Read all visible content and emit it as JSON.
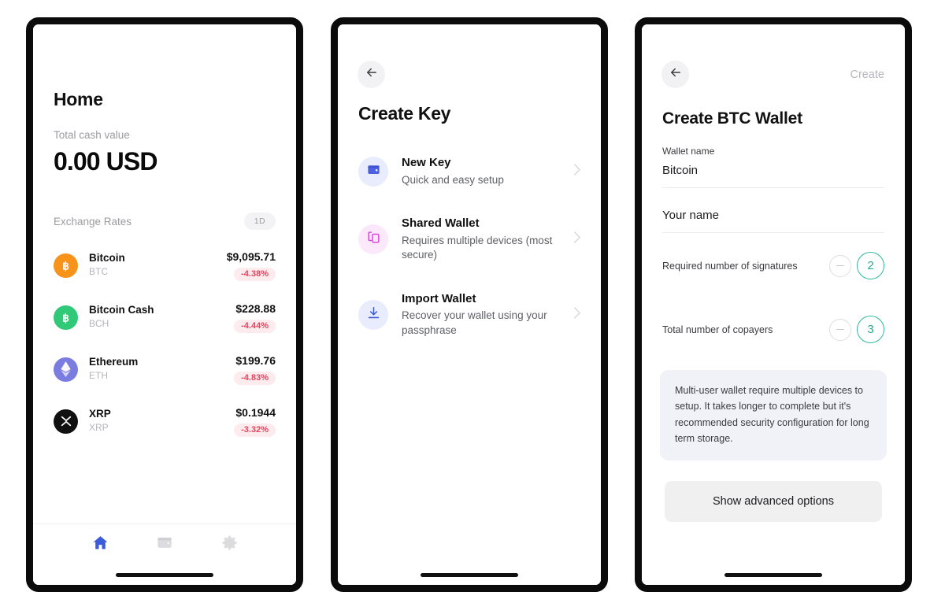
{
  "screen1": {
    "title": "Home",
    "balance_label": "Total cash value",
    "balance_value": "0.00 USD",
    "rates_label": "Exchange Rates",
    "range_badge": "1D",
    "coins": [
      {
        "name": "Bitcoin",
        "ticker": "BTC",
        "price": "$9,095.71",
        "change": "-4.38%",
        "icon": "bitcoin-icon",
        "color": "#f7931a"
      },
      {
        "name": "Bitcoin Cash",
        "ticker": "BCH",
        "price": "$228.88",
        "change": "-4.44%",
        "icon": "bitcoin-cash-icon",
        "color": "#2fc978"
      },
      {
        "name": "Ethereum",
        "ticker": "ETH",
        "price": "$199.76",
        "change": "-4.83%",
        "icon": "ethereum-icon",
        "color": "#7b7ce0"
      },
      {
        "name": "XRP",
        "ticker": "XRP",
        "price": "$0.1944",
        "change": "-3.32%",
        "icon": "xrp-icon",
        "color": "#101010"
      }
    ],
    "tabs": [
      {
        "icon": "home-icon",
        "active": true
      },
      {
        "icon": "wallet-icon",
        "active": false
      },
      {
        "icon": "gear-icon",
        "active": false
      }
    ]
  },
  "screen2": {
    "back_icon": "back-arrow-icon",
    "title": "Create Key",
    "options": [
      {
        "title": "New Key",
        "subtitle": "Quick and easy setup",
        "icon": "wallet-icon",
        "icon_color": "#4c61e0",
        "icon_bg": "#e8ecfd"
      },
      {
        "title": "Shared Wallet",
        "subtitle": "Requires multiple devices (most secure)",
        "icon": "copy-icon",
        "icon_color": "#d849d8",
        "icon_bg": "#fbe9fb"
      },
      {
        "title": "Import Wallet",
        "subtitle": "Recover your wallet using your passphrase",
        "icon": "download-icon",
        "icon_color": "#3f5bd4",
        "icon_bg": "#e8ecfd"
      }
    ]
  },
  "screen3": {
    "back_icon": "back-arrow-icon",
    "create_action": "Create",
    "title": "Create BTC Wallet",
    "wallet_name_label": "Wallet name",
    "wallet_name_value": "Bitcoin",
    "your_name_placeholder": "Your name",
    "signatures_label": "Required number of signatures",
    "signatures_value": "2",
    "copayers_label": "Total number of copayers",
    "copayers_value": "3",
    "info_text": "Multi-user wallet require multiple devices to setup. It takes longer to complete but it's recommended security configuration for long term storage.",
    "advanced_button": "Show advanced options",
    "accent_color": "#2fb79e"
  }
}
